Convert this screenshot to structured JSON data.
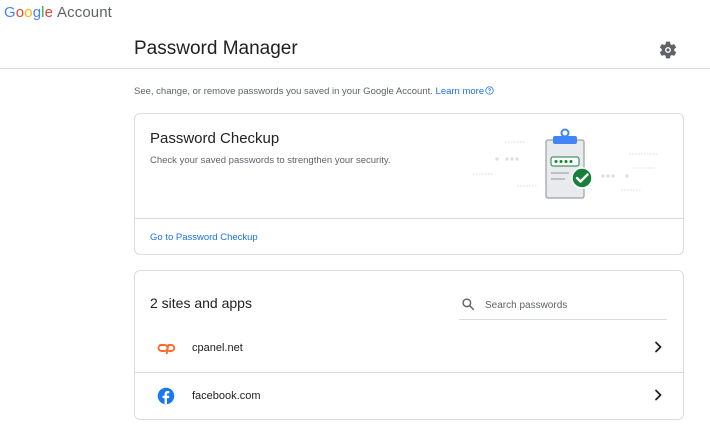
{
  "brand": {
    "logo": "Google",
    "suffix": "Account"
  },
  "page": {
    "title": "Password Manager"
  },
  "icons": {
    "settings": "gear-icon"
  },
  "description": {
    "text": "See, change, or remove passwords you saved in your Google Account. ",
    "link": "Learn more"
  },
  "checkup": {
    "title": "Password Checkup",
    "subtitle": "Check your saved passwords to strengthen your security.",
    "link": "Go to Password Checkup"
  },
  "sites": {
    "title": "2 sites and apps",
    "search_placeholder": "Search passwords",
    "items": [
      {
        "name": "cpanel.net",
        "icon": "cpanel-icon"
      },
      {
        "name": "facebook.com",
        "icon": "facebook-icon"
      }
    ]
  },
  "colors": {
    "link_blue": "#1a73e8",
    "check_green": "#188038",
    "cpanel_orange": "#ff6c2c",
    "facebook_blue": "#1877f2",
    "divider": "#dadce0"
  }
}
